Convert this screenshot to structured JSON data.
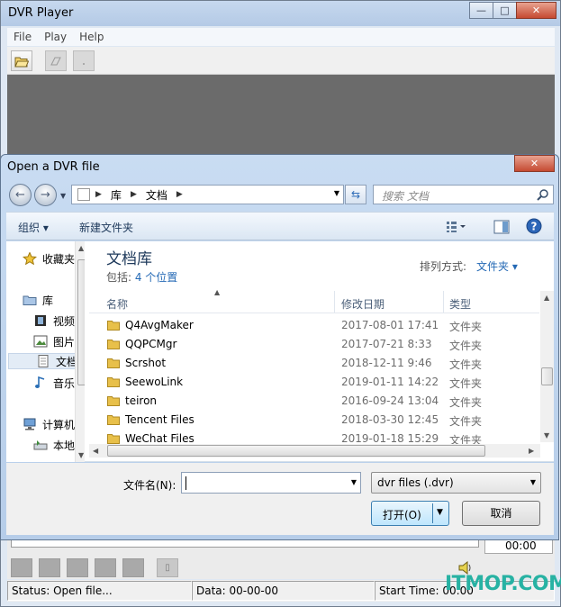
{
  "app": {
    "title": "DVR Player",
    "window_buttons": {
      "minimize": "—",
      "maximize": "□",
      "close": "✕"
    },
    "menu": [
      "File",
      "Play",
      "Help"
    ],
    "time_display": "00:00",
    "status": {
      "status_text": "Status: Open file...",
      "data_text": "Data: 00-00-00",
      "start_time_text": "Start Time: 00:00"
    }
  },
  "dialog": {
    "title": "Open a DVR file",
    "address": [
      "库",
      "文档"
    ],
    "search_placeholder": "搜索 文档",
    "organize_label": "组织 ▾",
    "new_folder_label": "新建文件夹",
    "nav_pane": [
      {
        "label": "收藏夹",
        "icon": "star-icon"
      },
      {
        "label": "库",
        "icon": "library-icon"
      },
      {
        "label": "视频",
        "icon": "video-icon"
      },
      {
        "label": "图片",
        "icon": "picture-icon"
      },
      {
        "label": "文档",
        "icon": "document-icon",
        "selected": true
      },
      {
        "label": "音乐",
        "icon": "music-icon"
      },
      {
        "label": "计算机",
        "icon": "computer-icon"
      },
      {
        "label": "本地",
        "icon": "drive-icon"
      }
    ],
    "library_title": "文档库",
    "includes_prefix": "包括: ",
    "includes_link": "4 个位置",
    "arrange_label": "排列方式:",
    "arrange_value": "文件夹 ▾",
    "columns": {
      "name": "名称",
      "modified": "修改日期",
      "type": "类型"
    },
    "files": [
      {
        "name": "Q4AvgMaker",
        "modified": "2017-08-01 17:41",
        "type": "文件夹"
      },
      {
        "name": "QQPCMgr",
        "modified": "2017-07-21 8:33",
        "type": "文件夹"
      },
      {
        "name": "Scrshot",
        "modified": "2018-12-11 9:46",
        "type": "文件夹"
      },
      {
        "name": "SeewoLink",
        "modified": "2019-01-11 14:22",
        "type": "文件夹"
      },
      {
        "name": "teiron",
        "modified": "2016-09-24 13:04",
        "type": "文件夹"
      },
      {
        "name": "Tencent Files",
        "modified": "2018-03-30 12:45",
        "type": "文件夹"
      },
      {
        "name": "WeChat Files",
        "modified": "2019-01-18 15:29",
        "type": "文件夹"
      }
    ],
    "filename_label": "文件名(N):",
    "filename_value": "",
    "filetype_value": "dvr files (.dvr)",
    "open_label": "打开(O)",
    "cancel_label": "取消"
  },
  "watermark": "ITMOP.COM",
  "colors": {
    "folder": "#e8c04a",
    "link": "#2469b5",
    "watermark": "#27b2a3"
  }
}
